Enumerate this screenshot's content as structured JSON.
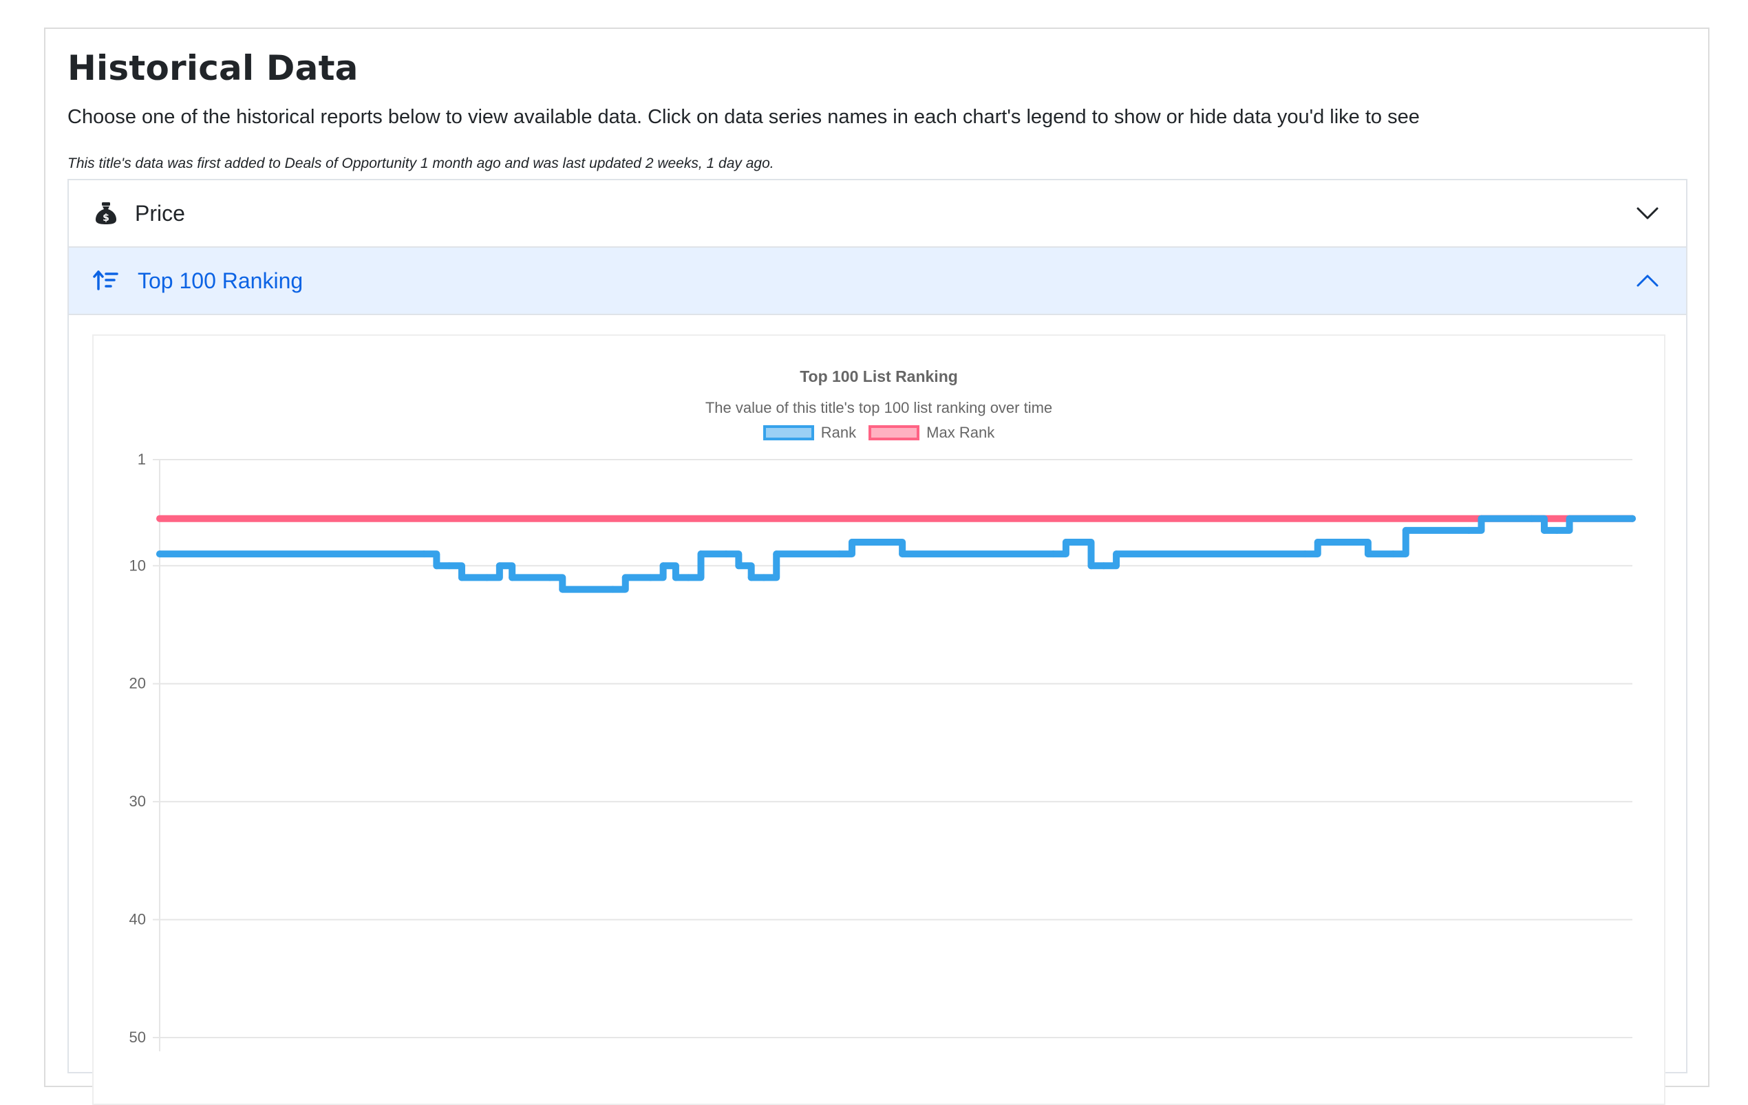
{
  "page": {
    "title": "Historical Data",
    "intro": "Choose one of the historical reports below to view available data. Click on data series names in each chart's legend to show or hide data you'd like to see",
    "meta_note": "This title's data was first added to Deals of Opportunity 1 month ago and was last updated 2 weeks, 1 day ago."
  },
  "accordion": {
    "price": {
      "label": "Price",
      "icon": "money-bag-icon",
      "state": "collapsed"
    },
    "ranking": {
      "label": "Top 100 Ranking",
      "icon": "sort-ascending-icon",
      "state": "expanded"
    }
  },
  "colors": {
    "rank": "#36a2eb",
    "rank_fill": "#9ad0f5",
    "max_rank": "#ff6384",
    "max_rank_fill": "#ffb1c1",
    "accent": "#0c63e4",
    "active_header_bg": "#e7f1ff"
  },
  "chart_data": {
    "type": "line",
    "title": "Top 100 List Ranking",
    "subtitle": "The value of this title's top 100 list ranking over time",
    "legend_position": "top",
    "grid": true,
    "y_reversed": true,
    "ylim": [
      1,
      50
    ],
    "yticks": [
      1,
      10,
      20,
      30,
      40,
      50
    ],
    "stepped": true,
    "x": [
      0,
      1,
      2,
      3,
      4,
      5,
      6,
      7,
      8,
      9,
      10,
      11,
      12,
      13,
      14,
      15,
      16,
      17,
      18,
      19,
      20,
      21,
      22,
      23,
      24,
      25,
      26,
      27,
      28,
      29,
      30,
      31,
      32,
      33,
      34,
      35,
      36,
      37,
      38,
      39,
      40,
      41,
      42,
      43,
      44,
      45,
      46,
      47,
      48,
      49,
      50,
      51,
      52,
      53,
      54,
      55,
      56,
      57,
      58,
      59,
      60,
      61,
      62,
      63,
      64,
      65,
      66,
      67,
      68,
      69,
      70,
      71,
      72,
      73,
      74,
      75,
      76,
      77,
      78,
      79,
      80,
      81,
      82,
      83,
      84,
      85,
      86,
      87,
      88,
      89,
      90,
      91,
      92,
      93,
      94,
      95,
      96,
      97,
      98,
      99,
      100,
      101,
      102,
      103,
      104,
      105,
      106,
      107,
      108,
      109,
      110,
      111,
      112,
      113,
      114,
      115,
      116,
      117
    ],
    "series": [
      {
        "name": "Rank",
        "values": [
          9,
          9,
          9,
          9,
          9,
          9,
          9,
          9,
          9,
          9,
          9,
          9,
          9,
          9,
          9,
          9,
          9,
          9,
          9,
          9,
          9,
          9,
          10,
          10,
          11,
          11,
          11,
          10,
          11,
          11,
          11,
          11,
          12,
          12,
          12,
          12,
          12,
          11,
          11,
          11,
          10,
          11,
          11,
          9,
          9,
          9,
          10,
          11,
          11,
          9,
          9,
          9,
          9,
          9,
          9,
          8,
          8,
          8,
          8,
          9,
          9,
          9,
          9,
          9,
          9,
          9,
          9,
          9,
          9,
          9,
          9,
          9,
          8,
          8,
          10,
          10,
          9,
          9,
          9,
          9,
          9,
          9,
          9,
          9,
          9,
          9,
          9,
          9,
          9,
          9,
          9,
          9,
          8,
          8,
          8,
          8,
          9,
          9,
          9,
          7,
          7,
          7,
          7,
          7,
          7,
          6,
          6,
          6,
          6,
          6,
          7,
          7,
          6,
          6,
          6,
          6,
          6,
          6
        ]
      },
      {
        "name": "Max Rank",
        "values": [
          6,
          6,
          6,
          6,
          6,
          6,
          6,
          6,
          6,
          6,
          6,
          6,
          6,
          6,
          6,
          6,
          6,
          6,
          6,
          6,
          6,
          6,
          6,
          6,
          6,
          6,
          6,
          6,
          6,
          6,
          6,
          6,
          6,
          6,
          6,
          6,
          6,
          6,
          6,
          6,
          6,
          6,
          6,
          6,
          6,
          6,
          6,
          6,
          6,
          6,
          6,
          6,
          6,
          6,
          6,
          6,
          6,
          6,
          6,
          6,
          6,
          6,
          6,
          6,
          6,
          6,
          6,
          6,
          6,
          6,
          6,
          6,
          6,
          6,
          6,
          6,
          6,
          6,
          6,
          6,
          6,
          6,
          6,
          6,
          6,
          6,
          6,
          6,
          6,
          6,
          6,
          6,
          6,
          6,
          6,
          6,
          6,
          6,
          6,
          6,
          6,
          6,
          6,
          6,
          6,
          6,
          6,
          6,
          6,
          6,
          6,
          6,
          6,
          6,
          6,
          6,
          6,
          6
        ]
      }
    ]
  }
}
